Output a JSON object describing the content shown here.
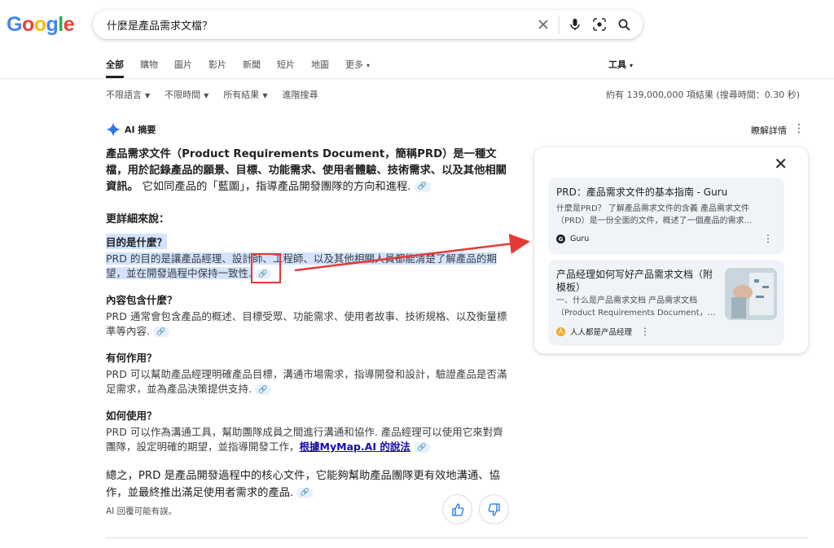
{
  "logo": [
    "G",
    "o",
    "o",
    "g",
    "l",
    "e"
  ],
  "search": {
    "query": "什麼是產品需求文檔？"
  },
  "tabs": [
    "全部",
    "購物",
    "圖片",
    "影片",
    "新聞",
    "短片",
    "地圖",
    "更多"
  ],
  "tools_label": "工具",
  "filters": [
    "不限語言",
    "不限時間",
    "所有結果",
    "進階搜尋"
  ],
  "stats": "約有 139,000,000 項結果 (搜尋時間：0.30 秒)",
  "ai_overview": {
    "title": "AI 摘要",
    "learn_more": "瞭解詳情",
    "intro_bold": "產品需求文件（Product Requirements Document，簡稱PRD）是一種文檔，用於記錄產品的願景、目標、功能需求、使用者體驗、技術需求、以及其他相關資訊。",
    "intro_plain": "它如同產品的「藍圖」，指導產品開發團隊的方向和進程.",
    "more_title": "更詳細來說：",
    "sections": [
      {
        "title": "目的是什麼？",
        "body": "PRD 的目的是讓產品經理、設計師、工程師、以及其他相關人員都能清楚了解產品的期望，並在開發過程中保持一致性."
      },
      {
        "title": "內容包含什麼？",
        "body": "PRD 通常會包含產品的概述、目標受眾、功能需求、使用者故事、技術規格、以及衡量標準等內容."
      },
      {
        "title": "有何作用？",
        "body": "PRD 可以幫助產品經理明確產品目標，溝通市場需求，指導開發和設計，驗證產品是否滿足需求，並為產品決策提供支持."
      },
      {
        "title": "如何使用？",
        "body": "PRD 可以作為溝通工具，幫助團隊成員之間進行溝通和協作. 產品經理可以使用它來對齊團隊，設定明確的期望，並指導開發工作，",
        "link": "根據MyMap.AI 的說法"
      }
    ],
    "summary": "總之，PRD 是產品開發過程中的核心文件，它能夠幫助產品團隊更有效地溝通、協作，並最終推出滿足使用者需求的產品.",
    "disclaimer": "AI 回覆可能有誤。"
  },
  "sources": [
    {
      "title": "PRD：產品需求文件的基本指南 - Guru",
      "snippet": "什麼是PRD？ 了解產品需求文件的含義 產品需求文件（PRD）是一份全面的文件，概述了一個產品的需求…",
      "site": "Guru"
    },
    {
      "title": "产品经理如何写好产品需求文档（附模板）",
      "snippet": "一、什么是产品需求文档 产品需求文档（Product Requirements Document，…",
      "site": "人人都是产品经理"
    }
  ],
  "colors": {
    "accent_highlight": "#d3e3fd",
    "annotation_red": "#e53935",
    "link": "#1a0dab"
  }
}
